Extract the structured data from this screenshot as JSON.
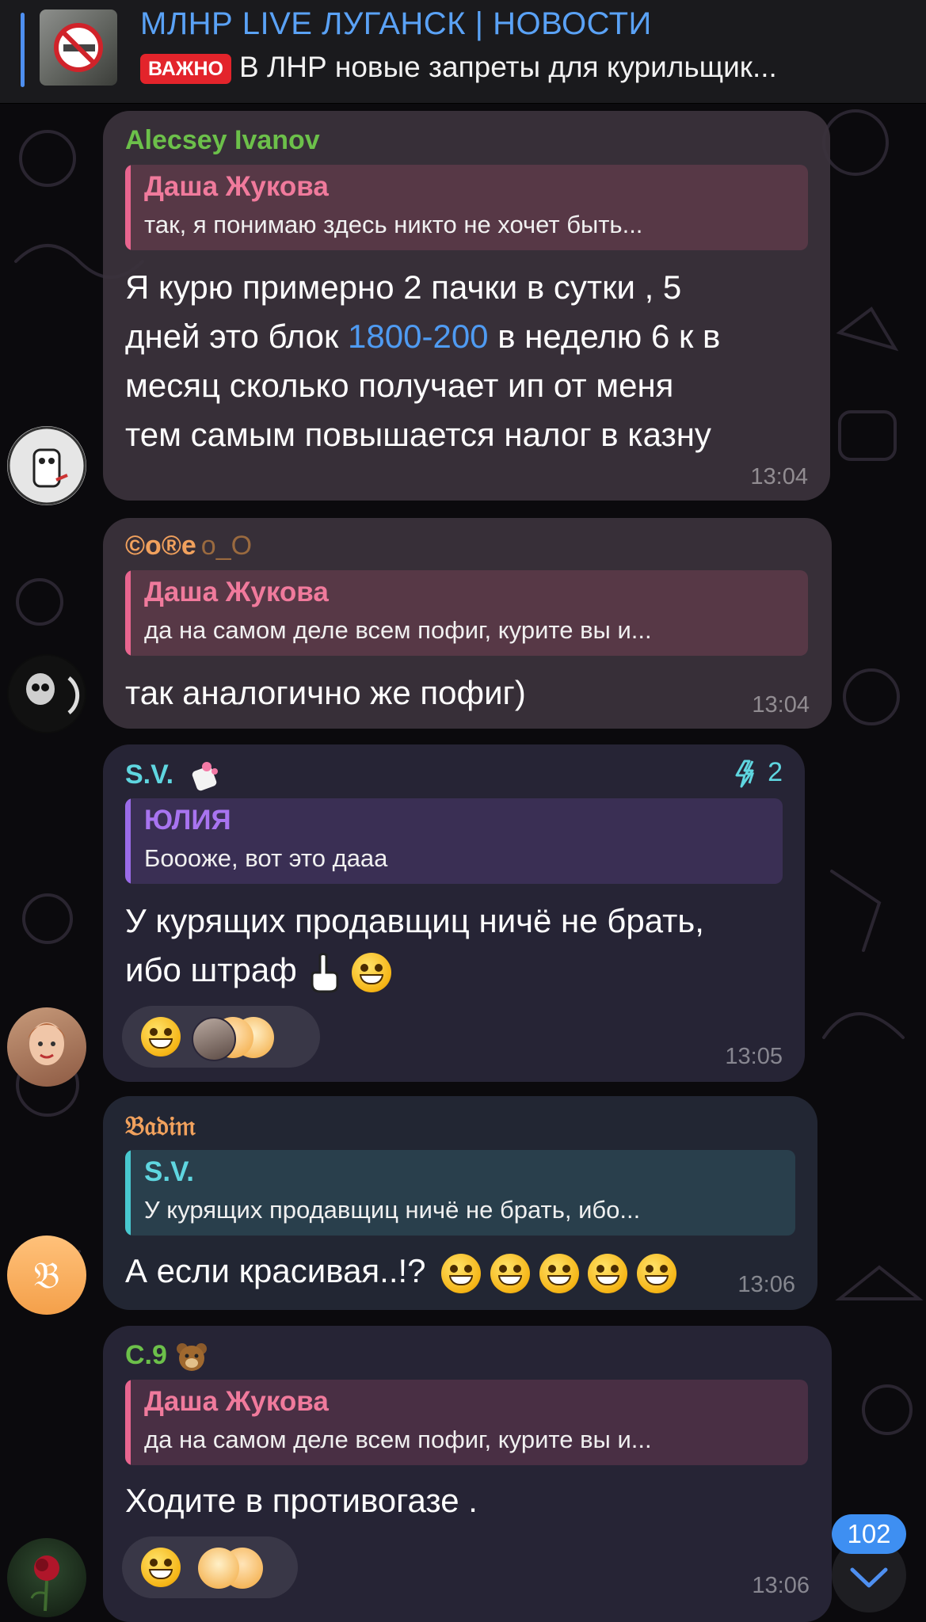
{
  "pinned": {
    "channel_title": "МЛНР LIVE ЛУГАНСК | НОВОСТИ",
    "badge": "ВАЖНО",
    "preview": "В ЛНР новые запреты для курильщик..."
  },
  "messages": [
    {
      "sender": "Alecsey Ivanov",
      "sender_color": "#6cc04a",
      "reply_name": "Даша Жукова",
      "reply_text": "так, я понимаю здесь никто не хочет быть...",
      "text_lines": [
        "Я курю примерно 2 пачки в сутки , 5",
        "дней это блок ",
        "1800-200",
        " в неделю 6 к в",
        "месяц сколько получает ип от меня",
        "тем самым повышается налог в казну"
      ],
      "time": "13:04"
    },
    {
      "sender": "©o®e",
      "sender_suffix": "o_O",
      "sender_color": "#f1a15d",
      "reply_name": "Даша Жукова",
      "reply_text": "да на самом деле всем пофиг, курите вы и...",
      "text": "так аналогично же пофиг)",
      "time": "13:04"
    },
    {
      "sender": "S.V.",
      "sender_color": "#5fd6e0",
      "boost_count": "2",
      "reply_name": "Юлия",
      "reply_text": "Бoooже, вот это дааа",
      "text_line1": "У курящих продавщиц ничё не брать,",
      "text_line2": "ибо штраф",
      "time": "13:05"
    },
    {
      "sender": "𝔅𝔞𝔡𝔦𝔪",
      "sender_color": "#f1a15d",
      "reply_name": "S.V.",
      "reply_text": "У курящих продавщиц ничё не брать, ибо...",
      "text": "А если красивая..!?",
      "avatar_letter": "𝔅",
      "time": "13:06"
    },
    {
      "sender": "С.9",
      "sender_color": "#6cc04a",
      "reply_name": "Даша Жукова",
      "reply_text": "да на самом деле всем пофиг, курите вы и...",
      "text": "Ходите в противогазе .",
      "time": "13:06"
    }
  ],
  "unread_count": "102",
  "icons": {
    "scroll_down": "chevron-down-icon",
    "boost": "boost-lightning-icon"
  }
}
